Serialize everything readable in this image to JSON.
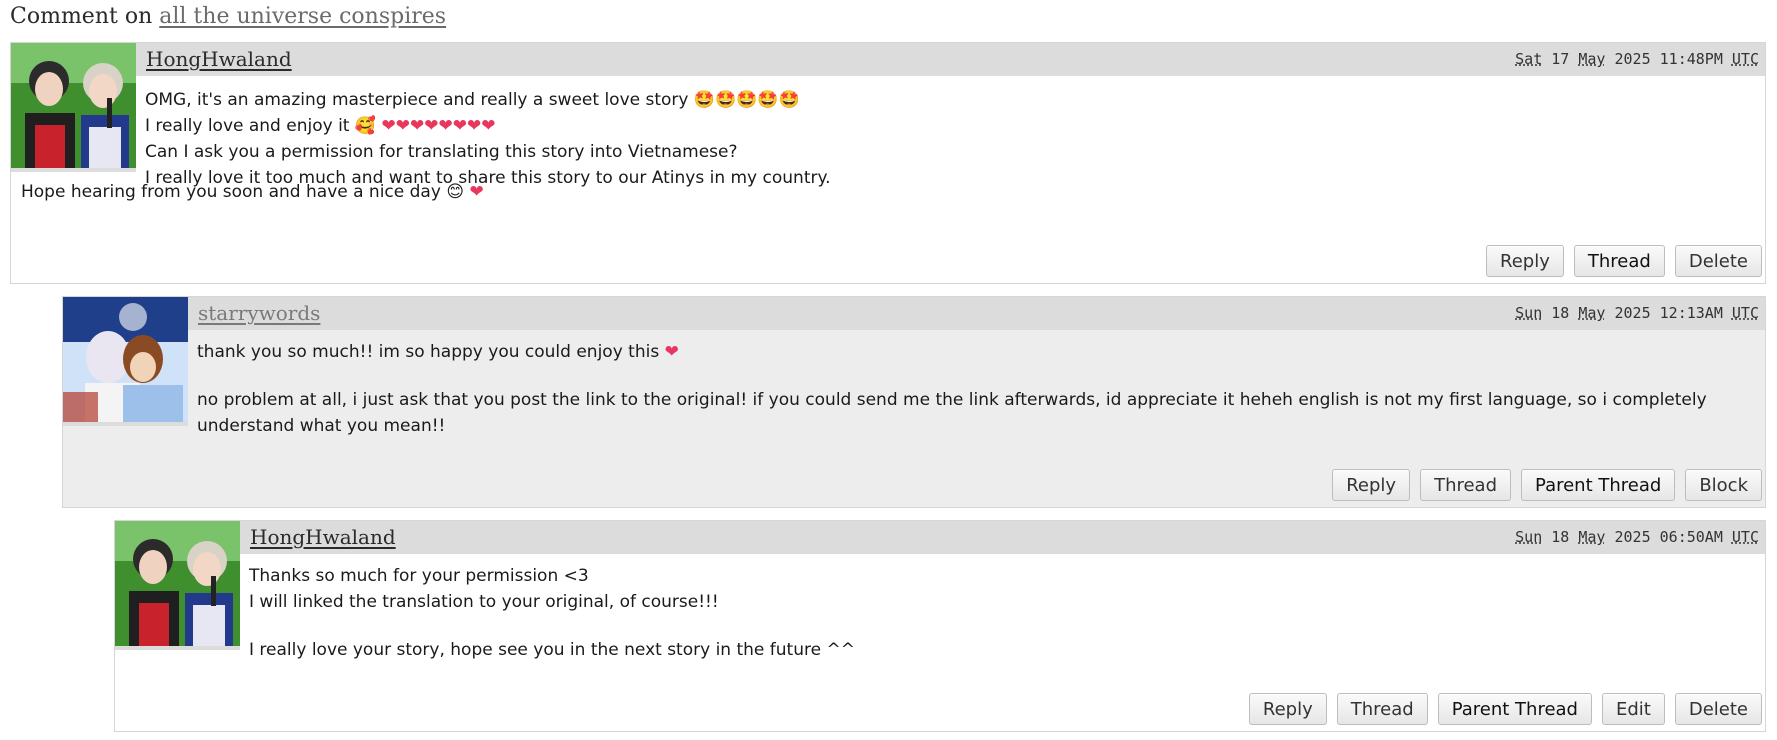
{
  "page": {
    "comment_on_prefix": "Comment on",
    "work_title": "all the universe conspires"
  },
  "comments": [
    {
      "author": "HongHwaland",
      "date": {
        "dow": "Sat",
        "day": "17",
        "month": "May",
        "year": "2025",
        "time": "11:48PM",
        "tz": "UTC"
      },
      "lines": [
        "OMG, it's an amazing masterpiece and really a sweet love story",
        "I really love and enjoy it",
        "Can I ask you a permission for translating this story into Vietnamese?",
        "I really love it too much and want to share this story to our Atinys in my country.",
        "Hope hearing from you soon and have a nice day"
      ],
      "actions": [
        "Reply",
        "Thread",
        "Delete"
      ]
    },
    {
      "author": "starrywords",
      "date": {
        "dow": "Sun",
        "day": "18",
        "month": "May",
        "year": "2025",
        "time": "12:13AM",
        "tz": "UTC"
      },
      "lines": [
        "thank you so much!! im so happy you could enjoy this",
        "no problem at all, i just ask that you post the link to the original! if you could send me the link afterwards, id appreciate it heheh english is not my first language, so i completely understand what you mean!!"
      ],
      "actions": [
        "Reply",
        "Thread",
        "Parent Thread",
        "Block"
      ]
    },
    {
      "author": "HongHwaland",
      "date": {
        "dow": "Sun",
        "day": "18",
        "month": "May",
        "year": "2025",
        "time": "06:50AM",
        "tz": "UTC"
      },
      "lines": [
        "Thanks so much for your permission <3",
        "I will linked the translation to your original, of course!!!",
        "I really love your story, hope see you in the next story in the future ^^"
      ],
      "actions": [
        "Reply",
        "Thread",
        "Parent Thread",
        "Edit",
        "Delete"
      ]
    }
  ],
  "icons": {
    "emoji_star_eyes": "🤩",
    "emoji_kiss": "🥰",
    "emoji_heart": "❤",
    "emoji_smile": "😊"
  }
}
